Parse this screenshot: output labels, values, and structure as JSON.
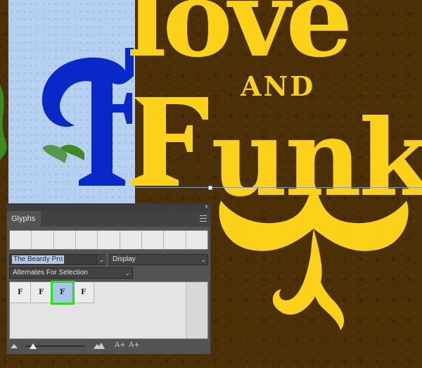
{
  "artwork": {
    "word_love": "love",
    "word_and": "AND",
    "word_funk_rest": "unk",
    "big_letter": "F",
    "colors": {
      "background": "#4b3007",
      "letters": "#fbd11a",
      "selected_glyph": "#0829c7",
      "selection_highlight": "#b6d0f2",
      "leaf_green": "#3f8a1e"
    }
  },
  "panel": {
    "tab_label": "Glyphs",
    "collapse_icon": "double-chevron-icon",
    "menu_icon": "hamburger-menu-icon",
    "font_family": "The Beardy Pro",
    "font_style": "Display",
    "show_mode": "Alternates For Selection",
    "glyphs": [
      "F",
      "F",
      "F",
      "F"
    ],
    "selected_index": 2,
    "colors": {
      "panel_bg": "#535353",
      "grid_bg": "#e4e4e4",
      "selected_cell": "#aac4ec",
      "highlight_box": "#29e01a"
    },
    "footer": {
      "small_icon": "mountain-small-icon",
      "large_icon": "mountain-large-icon",
      "zoom_in": "A+",
      "zoom_out": "A+"
    }
  }
}
